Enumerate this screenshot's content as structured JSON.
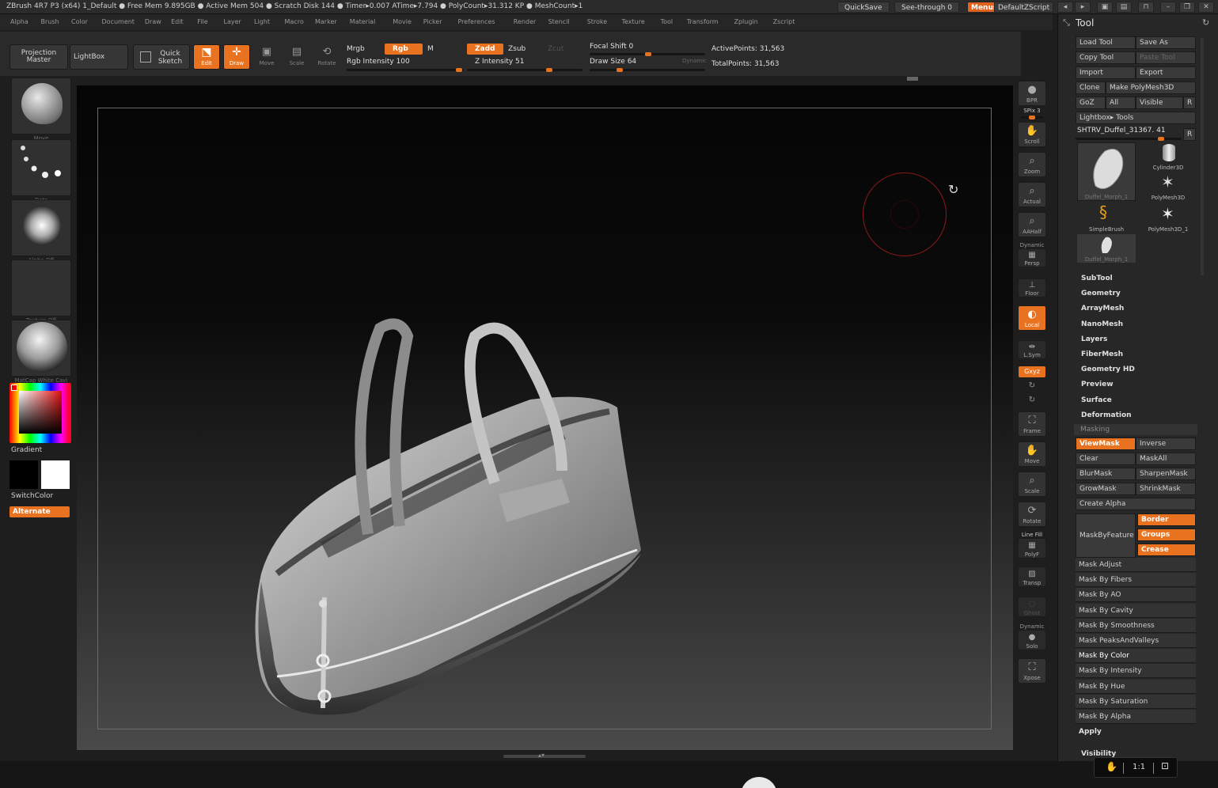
{
  "titlebar": {
    "text": "ZBrush 4R7 P3 (x64)   1_Default   ● Free Mem 9.895GB ● Active Mem 504 ● Scratch Disk 144 ● Timer▸0.007 ATime▸7.794 ● PolyCount▸31.312 KP ● MeshCount▸1",
    "quicksave": "QuickSave",
    "see_through": "See-through  0",
    "menus": "Menus",
    "script": "DefaultZScript"
  },
  "menubar": [
    "Alpha",
    "Brush",
    "Color",
    "Document",
    "Draw",
    "Edit",
    "File",
    "Layer",
    "Light",
    "Macro",
    "Marker",
    "Material",
    "Movie",
    "Picker",
    "Preferences",
    "Render",
    "Stencil",
    "Stroke",
    "Texture",
    "Tool",
    "Transform",
    "Zplugin",
    "Zscript"
  ],
  "toolbar": {
    "projection_master": "Projection Master",
    "lightbox": "LightBox",
    "quick_sketch": "Quick Sketch",
    "edit": "Edit",
    "draw": "Draw",
    "move": "Move",
    "scale": "Scale",
    "rotate": "Rotate",
    "mrgb": "Mrgb",
    "rgb": "Rgb",
    "m": "M",
    "rgb_intensity": "Rgb Intensity 100",
    "zadd": "Zadd",
    "zsub": "Zsub",
    "zcut": "Zcut",
    "z_intensity": "Z Intensity 51",
    "focal_shift": "Focal Shift 0",
    "draw_size": "Draw Size 64",
    "dynamic": "Dynamic",
    "active_points": "ActivePoints: 31,563",
    "total_points": "TotalPoints: 31,563"
  },
  "leftshelf": {
    "brush": "Move",
    "stroke": "Dots",
    "alpha": "Alpha Off",
    "texture": "Texture Off",
    "material": "MatCap White Cavi",
    "gradient": "Gradient",
    "switchcolor": "SwitchColor",
    "alternate": "Alternate"
  },
  "rightshelf": {
    "bpr": "BPR",
    "spix": "SPix 3",
    "scroll": "Scroll",
    "zoom": "Zoom",
    "actual": "Actual",
    "aahalf": "AAHalf",
    "dynamic_persp": "Dynamic",
    "persp": "Persp",
    "floor": "Floor",
    "local": "Local",
    "lsym": "L.Sym",
    "xyz": "Gxyz",
    "frame": "Frame",
    "move": "Move",
    "scale": "Scale",
    "rotate": "Rotate",
    "line_fill": "Line Fill",
    "polyf": "PolyF",
    "transp": "Transp",
    "ghost": "Ghost",
    "dynamic_solo": "Dynamic",
    "solo": "Solo",
    "xpose": "Xpose"
  },
  "toolpanel": {
    "title": "Tool",
    "load_tool": "Load Tool",
    "save_as": "Save As",
    "copy_tool": "Copy Tool",
    "paste_tool": "Paste Tool",
    "import": "Import",
    "export": "Export",
    "clone": "Clone",
    "make_polymesh": "Make PolyMesh3D",
    "goz": "GoZ",
    "all": "All",
    "visible": "Visible",
    "r": "R",
    "lightbox_tools": "Lightbox▸ Tools",
    "current_tool": "SHTRV_Duffel_31367. 41",
    "tools": [
      {
        "name": "Duffel_Morph_1"
      },
      {
        "name": "Cylinder3D"
      },
      {
        "name": "PolyMesh3D"
      },
      {
        "name": "SimpleBrush"
      },
      {
        "name": "PolyMesh3D_1"
      },
      {
        "name": "Duffel_Morph_1"
      }
    ],
    "sections": [
      "SubTool",
      "Geometry",
      "ArrayMesh",
      "NanoMesh",
      "Layers",
      "FiberMesh",
      "Geometry HD",
      "Preview",
      "Surface",
      "Deformation"
    ],
    "masking": "Masking",
    "viewmask": "ViewMask",
    "inverse": "Inverse",
    "clear": "Clear",
    "maskall": "MaskAll",
    "blurmask": "BlurMask",
    "sharpenmask": "SharpenMask",
    "growmask": "GrowMask",
    "shrinkmask": "ShrinkMask",
    "create_alpha": "Create Alpha",
    "maskbyfeature": "MaskByFeature",
    "border": "Border",
    "groups": "Groups",
    "crease": "Crease",
    "mask_items": [
      "Mask Adjust",
      "Mask By Fibers",
      "Mask By AO",
      "Mask By Cavity",
      "Mask By Smoothness",
      "Mask PeaksAndValleys",
      "Mask By Color",
      "Mask By Intensity",
      "Mask By Hue",
      "Mask By Saturation",
      "Mask By Alpha"
    ],
    "apply": "Apply",
    "visibility": "Visibility"
  },
  "bottom": {
    "ratio": "1:1"
  },
  "colors": {
    "accent": "#e8721f",
    "panel": "#272727"
  }
}
